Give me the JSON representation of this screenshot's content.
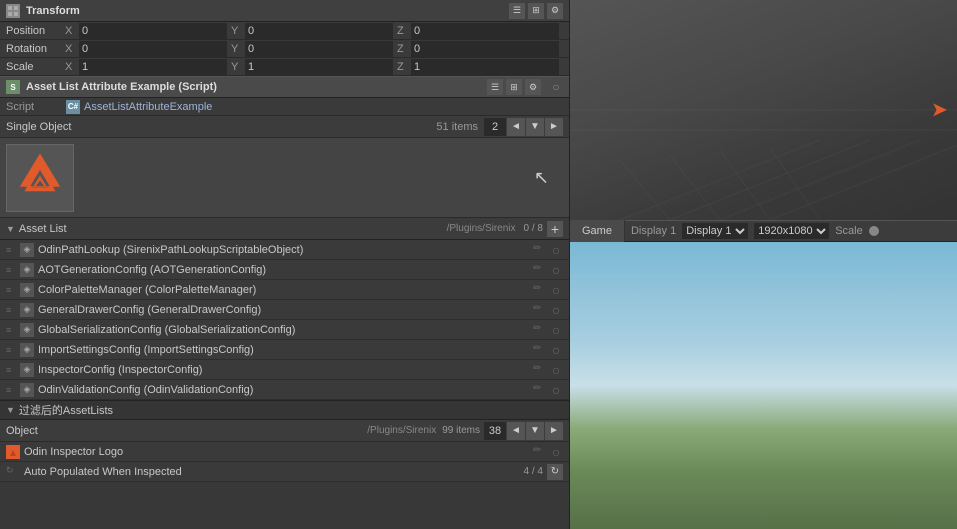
{
  "transform": {
    "title": "Transform",
    "header_icons": [
      "☰",
      "↕",
      "⚙"
    ],
    "rows": [
      {
        "label": "Position",
        "fields": [
          {
            "axis": "X",
            "value": "0"
          },
          {
            "axis": "Y",
            "value": "0"
          },
          {
            "axis": "Z",
            "value": "0"
          }
        ]
      },
      {
        "label": "Rotation",
        "fields": [
          {
            "axis": "X",
            "value": "0"
          },
          {
            "axis": "Y",
            "value": "0"
          },
          {
            "axis": "Z",
            "value": "0"
          }
        ]
      },
      {
        "label": "Scale",
        "fields": [
          {
            "axis": "X",
            "value": "1"
          },
          {
            "axis": "Y",
            "value": "1"
          },
          {
            "axis": "Z",
            "value": "1"
          }
        ]
      }
    ]
  },
  "asset_attribute": {
    "title": "Asset List Attribute Example (Script)",
    "script_label": "Script",
    "script_file": "AssetListAttributeExample"
  },
  "single_object": {
    "label": "Single Object",
    "items_count": "51 items",
    "page_num": "2"
  },
  "asset_list": {
    "title": "Asset List",
    "path": "/Plugins/Sirenix",
    "count": "0 / 8",
    "items": [
      {
        "label": "OdinPathLookup (SirenixPathLookupScriptableObject)"
      },
      {
        "label": "AOTGenerationConfig (AOTGenerationConfig)"
      },
      {
        "label": "ColorPaletteManager (ColorPaletteManager)"
      },
      {
        "label": "GeneralDrawerConfig (GeneralDrawerConfig)"
      },
      {
        "label": "GlobalSerializationConfig (GlobalSerializationConfig)"
      },
      {
        "label": "ImportSettingsConfig (ImportSettingsConfig)"
      },
      {
        "label": "InspectorConfig (InspectorConfig)"
      },
      {
        "label": "OdinValidationConfig (OdinValidationConfig)"
      }
    ]
  },
  "filter_section": {
    "title": "过滤后的AssetLists"
  },
  "object_section": {
    "label": "Object",
    "path": "/Plugins/Sirenix",
    "items_count": "99 items",
    "page_num": "38"
  },
  "odin_row": {
    "label": "Odin Inspector Logo"
  },
  "auto_row": {
    "label": "Auto Populated When Inspected",
    "count": "4 / 4"
  },
  "game_tab": {
    "label": "Game",
    "display_label": "Display 1",
    "resolution": "1920x1080",
    "scale_label": "Scale"
  }
}
